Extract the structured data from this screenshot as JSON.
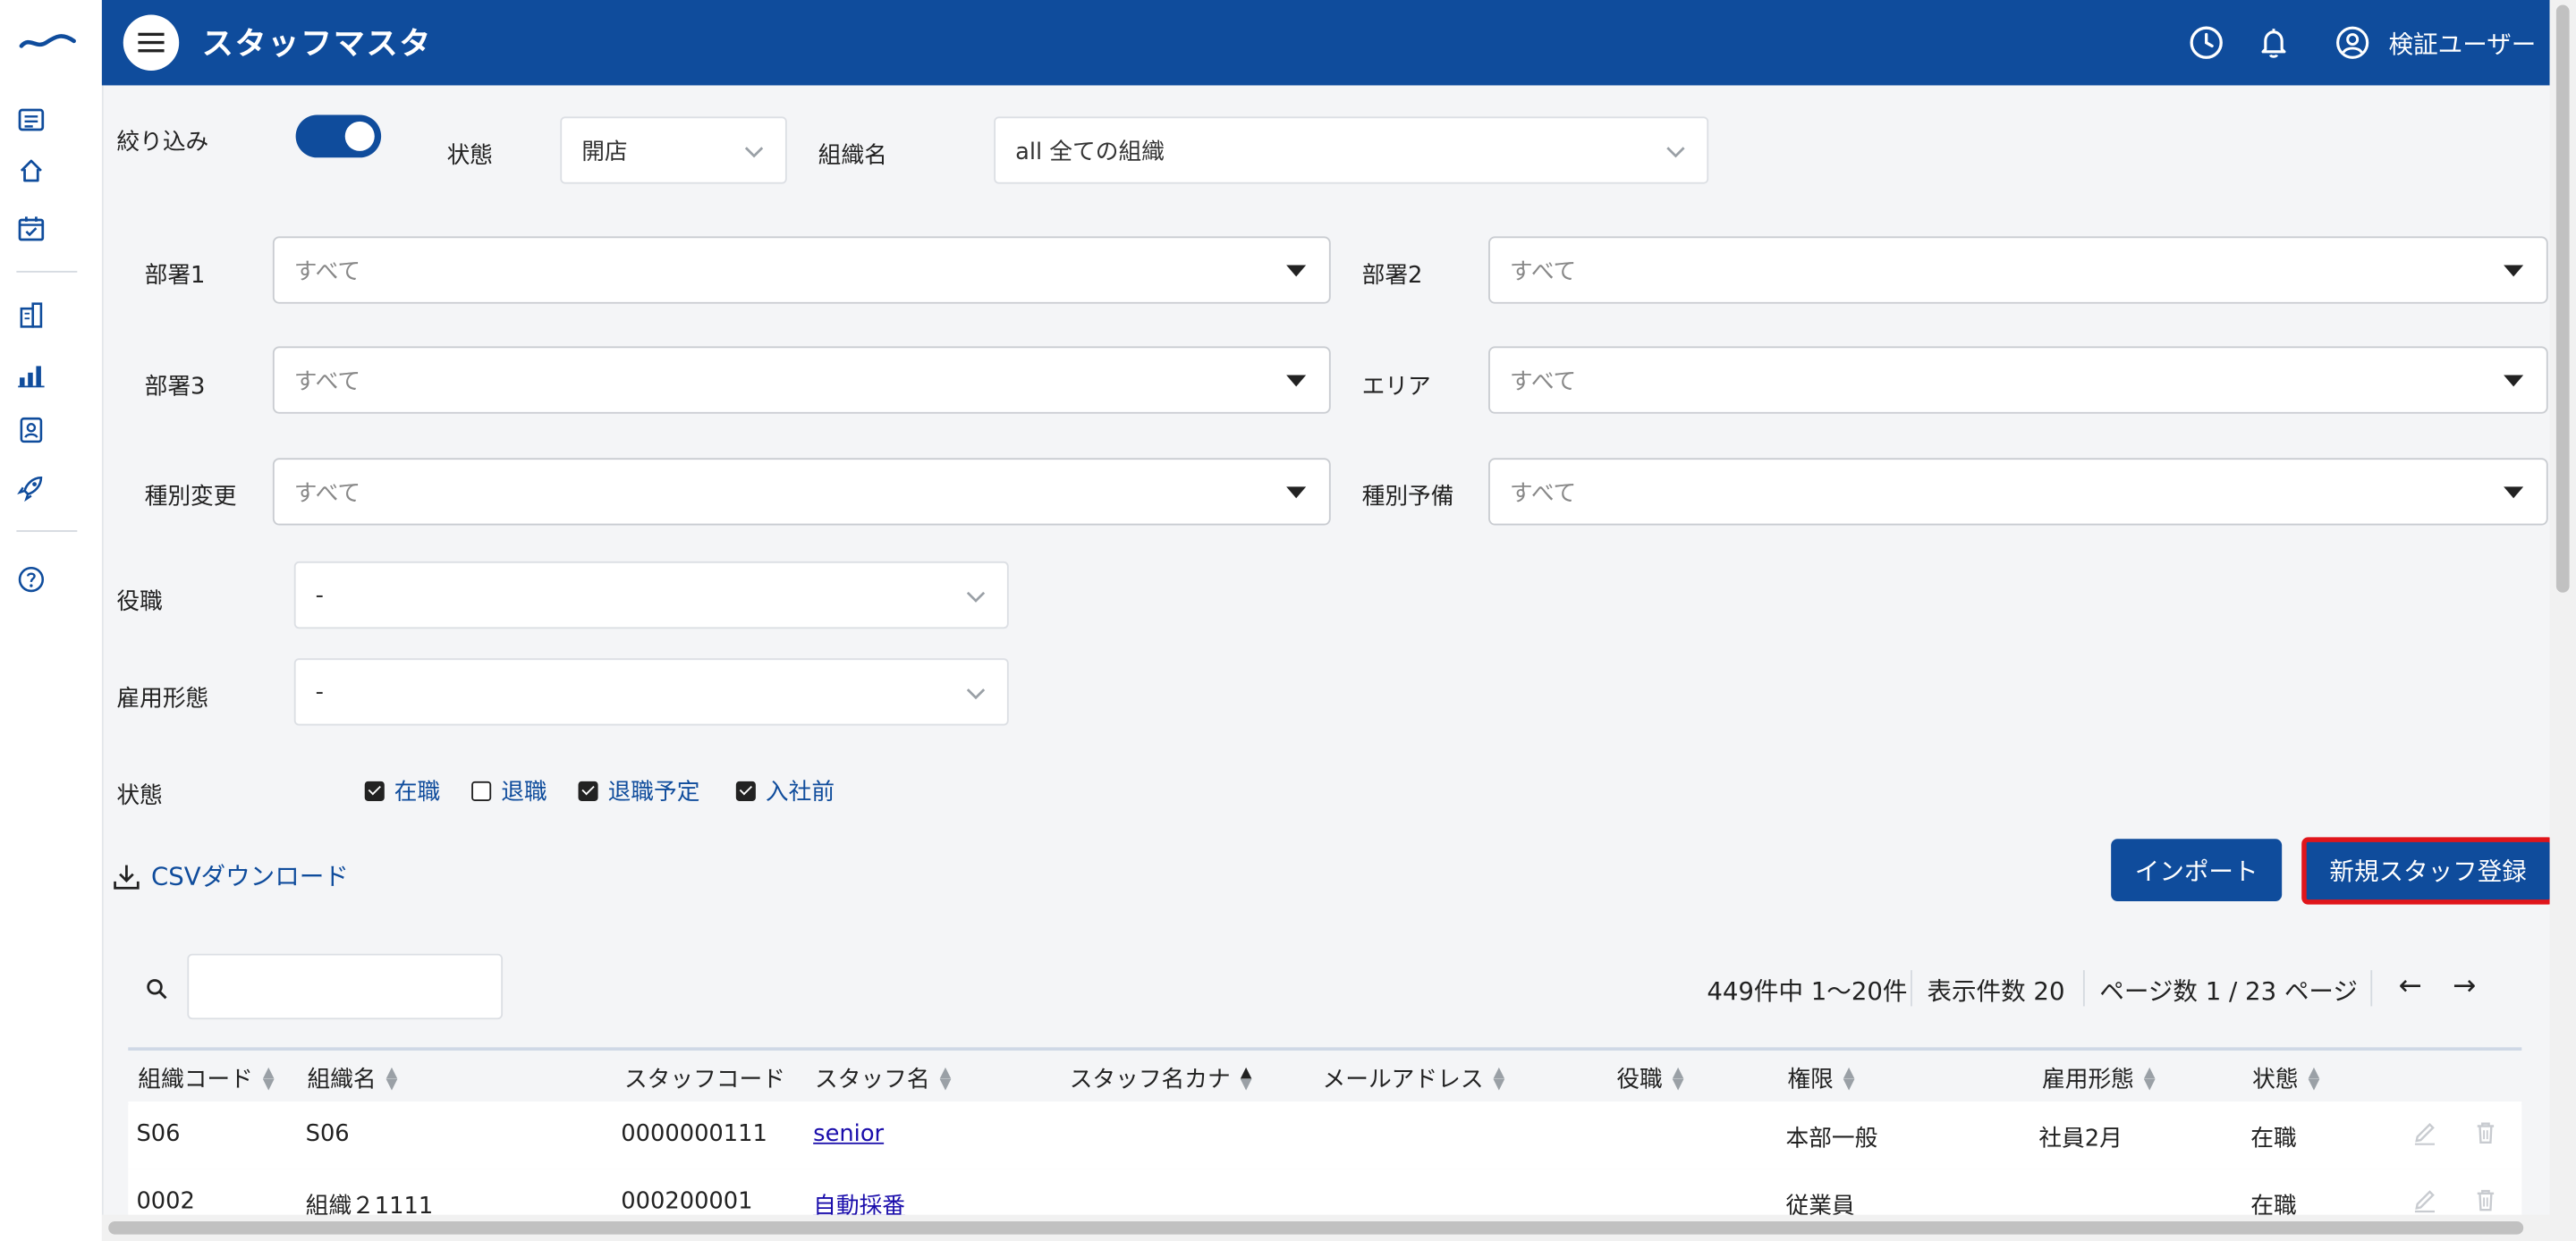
{
  "header": {
    "title": "スタッフマスタ",
    "user_name": "検証ユーザー"
  },
  "filters": {
    "narrow_label": "絞り込み",
    "narrow_enabled": true,
    "status_label": "状態",
    "status_value": "開店",
    "org_label": "組織名",
    "org_value": "all 全ての組織",
    "dept1_label": "部署1",
    "dept1_value": "すべて",
    "dept2_label": "部署2",
    "dept2_value": "すべて",
    "dept3_label": "部署3",
    "dept3_value": "すべて",
    "area_label": "エリア",
    "area_value": "すべて",
    "type_change_label": "種別変更",
    "type_change_value": "すべて",
    "type_reserve_label": "種別予備",
    "type_reserve_value": "すべて",
    "position_label": "役職",
    "position_value": "-",
    "employment_label": "雇用形態",
    "employment_value": "-",
    "staff_status_label": "状態",
    "staff_status_options": [
      {
        "label": "在職",
        "checked": true
      },
      {
        "label": "退職",
        "checked": false
      },
      {
        "label": "退職予定",
        "checked": true
      },
      {
        "label": "入社前",
        "checked": true
      }
    ]
  },
  "actions": {
    "csv_download": "CSVダウンロード",
    "import": "インポート",
    "new_staff": "新規スタッフ登録"
  },
  "search": {
    "placeholder": ""
  },
  "pagination": {
    "summary": "449件中 1〜20件",
    "per_page": "表示件数 20",
    "page_info": "ページ数 1 / 23 ページ",
    "prev": "←",
    "next": "→"
  },
  "table": {
    "columns": [
      "組織コード",
      "組織名",
      "スタッフコード",
      "スタッフ名",
      "スタッフ名カナ",
      "メールアドレス",
      "役職",
      "権限",
      "雇用形態",
      "状態"
    ],
    "rows": [
      {
        "org_code": "S06",
        "org_name": "S06",
        "staff_code": "0000000111",
        "staff_name": "senior",
        "kana": "",
        "email": "",
        "position": "",
        "role": "本部一般",
        "employment": "社員2月",
        "status": "在職"
      },
      {
        "org_code": "0002",
        "org_name": "組織２1111",
        "staff_code": "000200001",
        "staff_name": "自動採番",
        "kana": "",
        "email": "",
        "position": "",
        "role": "従業員",
        "employment": "",
        "status": "在職"
      }
    ]
  },
  "colors": {
    "brand": "#0f4c9c",
    "highlight_border": "#e0151b"
  }
}
